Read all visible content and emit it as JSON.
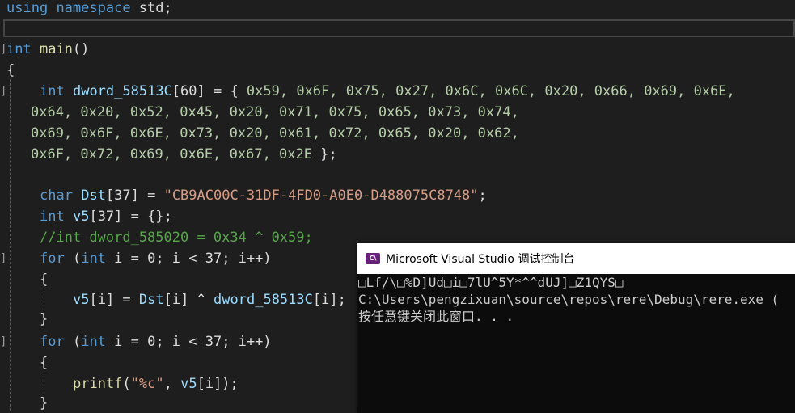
{
  "code": {
    "line_using": {
      "kw1": "using",
      "kw2": "namespace",
      "rest": " std;"
    },
    "line_main": {
      "kw": "int",
      "fn": "main",
      "rest": "()"
    },
    "open_brace": "{",
    "dword_decl": {
      "type": "int",
      "name": "dword_58513C",
      "bracket": "[60] = { ",
      "row1": "0x59, 0x6F, 0x75, 0x27, 0x6C, 0x6C, 0x20, 0x66, 0x69, 0x6E,",
      "row2": "0x64, 0x20, 0x52, 0x45, 0x20, 0x71, 0x75, 0x65, 0x73, 0x74,",
      "row3": "0x69, 0x6F, 0x6E, 0x73, 0x20, 0x61, 0x72, 0x65, 0x20, 0x62,",
      "row4": "0x6F, 0x72, 0x69, 0x6E, 0x67, 0x2E",
      "row4_end": " };"
    },
    "dst_decl": {
      "type": "char",
      "name": "Dst",
      "mid": "[37] = ",
      "str": "\"CB9AC00C-31DF-4FD0-A0E0-D488075C8748\"",
      "end": ";"
    },
    "v5_decl": {
      "type": "int",
      "name": "v5",
      "rest": "[37] = {};"
    },
    "comment": "//int dword_585020 = 0x34 ^ 0x59;",
    "for1": {
      "kw": "for",
      "open": " (",
      "type": "int",
      "body": " i = 0; i < 37; i++)"
    },
    "brace_open2": "{",
    "assign": {
      "lhs": "v5",
      "idx1": "[i] = ",
      "rhs1": "Dst",
      "idx2": "[i] ^ ",
      "rhs2": "dword_58513C",
      "idx3": "[i];"
    },
    "brace_close2": "}",
    "for2": {
      "kw": "for",
      "open": " (",
      "type": "int",
      "body": " i = 0; i < 37; i++)"
    },
    "brace_open3": "{",
    "printf": {
      "fn": "printf",
      "open": "(",
      "str": "\"%c\"",
      "rest": ", ",
      "arg": "v5",
      "end": "[i]);"
    },
    "brace_close3": "}"
  },
  "console": {
    "title": "Microsoft Visual Studio 调试控制台",
    "icon_label": "C\\",
    "lines": [
      "□Lf/\\□%D]Ud□i□7lU^5Y*^^dUJ]□Z1QYS□",
      "C:\\Users\\pengzixuan\\source\\repos\\rere\\Debug\\rere.exe (",
      "按任意键关闭此窗口. . ."
    ]
  },
  "colors": {
    "editor_bg": "#1e1e1e",
    "keyword": "#569cd6",
    "function": "#dcdcaa",
    "number": "#b5cea8",
    "string": "#d69d85",
    "comment": "#57a64a",
    "identifier": "#9cdcfe",
    "console_bg": "#0c0c0c",
    "console_text": "#cccccc"
  }
}
